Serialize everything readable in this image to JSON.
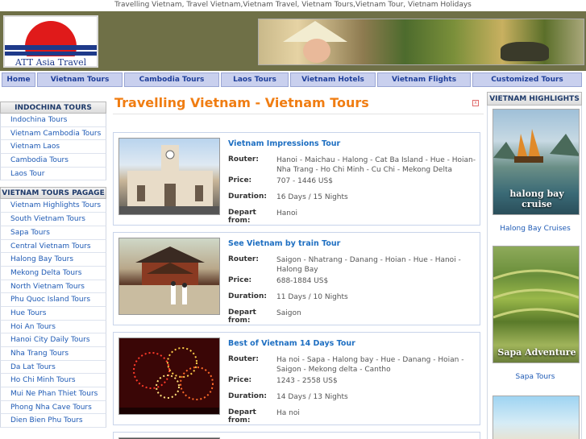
{
  "top_text": "Travelling Vietnam, Travel Vietnam,Vietnam Travel, Vietnam Tours,Vietnam Tour, Vietnam Holidays",
  "logo_text": "ATT Asia Travel",
  "nav": [
    "Home",
    "Vietnam Tours",
    "Cambodia Tours",
    "Laos Tours",
    "Vietnam Hotels",
    "Vietnam Flights",
    "Customized Tours"
  ],
  "left": {
    "section1_title": "INDOCHINA TOURS",
    "section1_items": [
      "Indochina Tours",
      "Vietnam Cambodia Tours",
      "Vietnam Laos",
      "Cambodia Tours",
      "Laos Tour"
    ],
    "section2_title": "VIETNAM TOURS PAGAGE",
    "section2_items": [
      "Vietnam Highlights Tours",
      "South Vietnam Tours",
      "Sapa Tours",
      "Central Vietnam Tours",
      "Halong Bay Tours",
      "Mekong Delta Tours",
      "North Vietnam Tours",
      "Phu Quoc Island Tours",
      "Hue Tours",
      "Hoi An Tours",
      "Hanoi City Daily Tours",
      "Nha Trang Tours",
      "Da Lat Tours",
      "Ho Chi Minh Tours",
      "Mui Ne Phan Thiet Tours",
      "Phong Nha Cave Tours",
      "Dien Bien Phu Tours"
    ]
  },
  "main": {
    "title": "Travelling Vietnam - Vietnam Tours",
    "labels": {
      "route": "Router:",
      "price": "Price:",
      "duration": "Duration:",
      "depart": "Depart from:"
    },
    "tours": [
      {
        "name": "Vietnam Impressions Tour",
        "route": "Hanoi - Maichau - Halong - Cat Ba Island - Hue - Hoian- Nha Trang - Ho Chi Minh - Cu Chi - Mekong Delta",
        "price": "707 - 1446 US$",
        "duration": "16 Days / 15 Nights",
        "depart": "Hanoi"
      },
      {
        "name": "See Vietnam by train Tour",
        "route": "Saigon - Nhatrang - Danang - Hoian - Hue - Hanoi - Halong Bay",
        "price": "688-1884 US$",
        "duration": "11 Days / 10 Nights",
        "depart": "Saigon"
      },
      {
        "name": "Best of Vietnam 14 Days Tour",
        "route": "Ha noi - Sapa - Halong bay - Hue - Danang - Hoian - Saigon - Mekong delta - Cantho",
        "price": "1243 - 2558 US$",
        "duration": "14 Days / 13 Nights",
        "depart": "Ha noi"
      }
    ]
  },
  "right": {
    "title": "VIETNAM HIGHLIGHTS",
    "items": [
      {
        "photo_text": "halong bay cruise",
        "caption": "Halong Bay Cruises"
      },
      {
        "photo_text": "Sapa Adventure",
        "caption": "Sapa Tours"
      }
    ]
  }
}
